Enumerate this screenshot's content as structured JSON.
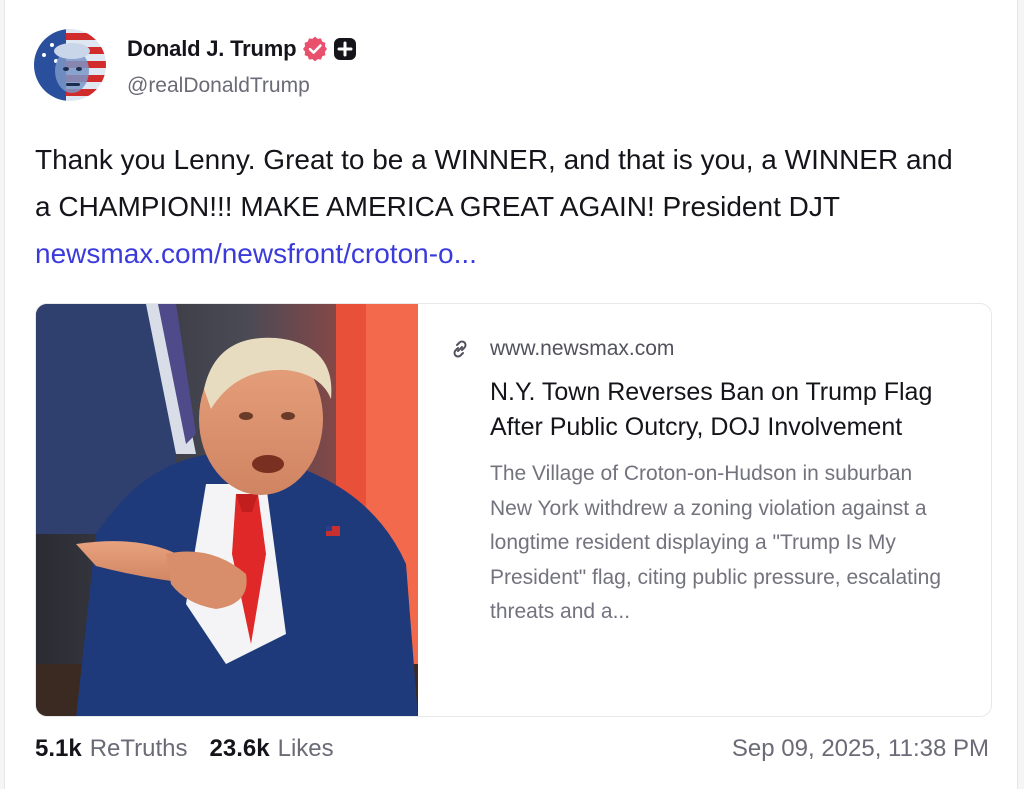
{
  "author": {
    "display_name": "Donald J. Trump",
    "handle": "@realDonaldTrump"
  },
  "post": {
    "text": "Thank you Lenny. Great to be a WINNER, and that is you, a WINNER and a CHAMPION!!! MAKE AMERICA GREAT AGAIN! President DJT ",
    "link_text": "newsmax.com/newsfront/croton-o..."
  },
  "link_card": {
    "domain": "www.newsmax.com",
    "headline": "N.Y. Town Reverses Ban on Trump Flag After Public Outcry, DOJ Involvement",
    "description": "The Village of Croton-on-Hudson in suburban New York withdrew a zoning violation against a longtime resident displaying a \"Trump Is My President\" flag, citing public pressure, escalating threats and a..."
  },
  "stats": {
    "retruths_count": "5.1k",
    "retruths_label": "ReTruths",
    "likes_count": "23.6k",
    "likes_label": "Likes",
    "timestamp": "Sep 09, 2025, 11:38 PM"
  },
  "colors": {
    "link": "#3b3bdc",
    "verified_badge": "#e8506b",
    "text_primary": "#14141a",
    "text_secondary": "#6b6b78"
  }
}
